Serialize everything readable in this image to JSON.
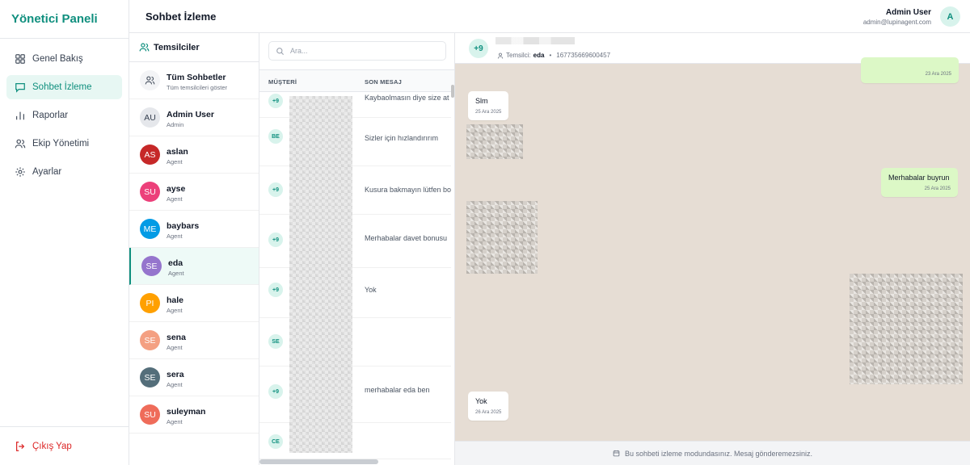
{
  "brand": "Yönetici Paneli",
  "nav": [
    {
      "label": "Genel Bakış",
      "icon": "grid-icon",
      "active": false
    },
    {
      "label": "Sohbet İzleme",
      "icon": "chat-icon",
      "active": true
    },
    {
      "label": "Raporlar",
      "icon": "bar-chart-icon",
      "active": false
    },
    {
      "label": "Ekip Yönetimi",
      "icon": "users-icon",
      "active": false
    },
    {
      "label": "Ayarlar",
      "icon": "gear-icon",
      "active": false
    }
  ],
  "logout": "Çıkış Yap",
  "header": {
    "title": "Sohbet İzleme",
    "user_name": "Admin User",
    "user_email": "admin@lupinagent.com",
    "user_initial": "A"
  },
  "agents": {
    "title": "Temsilciler",
    "all": {
      "name": "Tüm Sohbetler",
      "sub": "Tüm temsilcileri göster"
    },
    "list": [
      {
        "initials": "AU",
        "name": "Admin User",
        "role": "Admin",
        "color": "#e5e7eb"
      },
      {
        "initials": "AS",
        "name": "aslan",
        "role": "Agent",
        "color": "#c62828"
      },
      {
        "initials": "SU",
        "name": "ayse",
        "role": "Agent",
        "color": "#ec407a"
      },
      {
        "initials": "ME",
        "name": "baybars",
        "role": "Agent",
        "color": "#039be5"
      },
      {
        "initials": "SE",
        "name": "eda",
        "role": "Agent",
        "color": "#9575cd"
      },
      {
        "initials": "PI",
        "name": "hale",
        "role": "Agent",
        "color": "#ffa000"
      },
      {
        "initials": "SE",
        "name": "sena",
        "role": "Agent",
        "color": "#f4a082"
      },
      {
        "initials": "SE",
        "name": "sera",
        "role": "Agent",
        "color": "#546e7a"
      },
      {
        "initials": "SU",
        "name": "suleyman",
        "role": "Agent",
        "color": "#ef6c5a"
      }
    ]
  },
  "conversations": {
    "search_placeholder": "Ara...",
    "col_customer": "MÜŞTERİ",
    "col_last_message": "SON MESAJ",
    "rows": [
      {
        "badge": "+9",
        "message": "Kaybaolmasın diye size at"
      },
      {
        "badge": "BE",
        "message": "Sizler için hızlandırırım"
      },
      {
        "badge": "+9",
        "message": "Kusura bakmayın lütfen bo"
      },
      {
        "badge": "+9",
        "message": "Merhabalar davet bonusu"
      },
      {
        "badge": "+9",
        "message": "Yok"
      },
      {
        "badge": "SE",
        "message": ""
      },
      {
        "badge": "+9",
        "message": "merhabalar eda ben"
      },
      {
        "badge": "CE",
        "message": ""
      }
    ]
  },
  "chat": {
    "avatar": "+9",
    "agent_label": "Temsilci:",
    "agent_name": "eda",
    "phone": "167735669600457",
    "messages": [
      {
        "text": "Slm",
        "date": "25 Ara 2025",
        "dir": "in"
      },
      {
        "text": "Merhabalar buyrun",
        "date": "25 Ara 2025",
        "dir": "out"
      },
      {
        "text": "Yok",
        "date": "26 Ara 2025",
        "dir": "in"
      }
    ],
    "top_date": "23 Ara 2025",
    "footer": "Bu sohbeti izleme modundasınız. Mesaj gönderemezsiniz."
  }
}
